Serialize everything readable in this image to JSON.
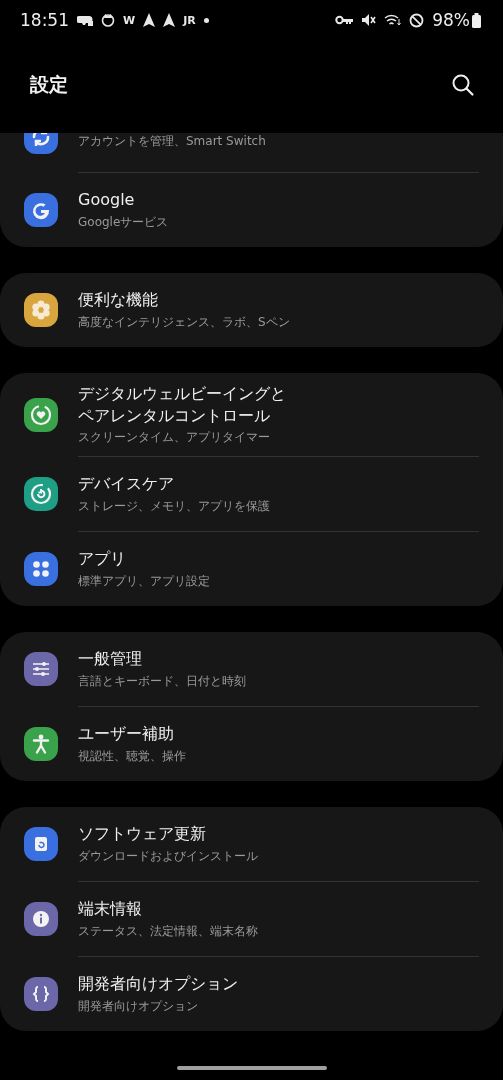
{
  "status_bar": {
    "time": "18:51",
    "notification_icons": [
      {
        "kind": "game"
      },
      {
        "kind": "cat"
      },
      {
        "kind": "text",
        "label": "W"
      },
      {
        "kind": "arrow"
      },
      {
        "kind": "arrow"
      },
      {
        "kind": "text",
        "label": "JR"
      },
      {
        "kind": "dot"
      }
    ],
    "system_icons": [
      {
        "kind": "key"
      },
      {
        "kind": "mute"
      },
      {
        "kind": "wifi"
      },
      {
        "kind": "dnd"
      }
    ],
    "battery": "98%"
  },
  "header": {
    "title": "設定"
  },
  "groups": [
    {
      "items": [
        {
          "kind": "sync",
          "color": "#3a6fe0",
          "subtitle": "アカウントを管理、Smart Switch",
          "cut": true
        },
        {
          "kind": "google",
          "color": "#3a6fe0",
          "title": "Google",
          "subtitle": "Googleサービス",
          "cut": false
        }
      ]
    },
    {
      "items": [
        {
          "kind": "flower",
          "color": "#d9a53f",
          "title": "便利な機能",
          "subtitle": "高度なインテリジェンス、ラボ、Sペン",
          "cut": false
        }
      ]
    },
    {
      "items": [
        {
          "kind": "wellbeing",
          "color": "#3aa24a",
          "title": "デジタルウェルビーイングとペアレンタルコントロール",
          "subtitle": "スクリーンタイム、アプリタイマー",
          "cut": false
        },
        {
          "kind": "devicecare",
          "color": "#1f9e86",
          "title": "デバイスケア",
          "subtitle": "ストレージ、メモリ、アプリを保護",
          "cut": false
        },
        {
          "kind": "apps",
          "color": "#3a6fe0",
          "title": "アプリ",
          "subtitle": "標準アプリ、アプリ設定",
          "cut": false
        }
      ]
    },
    {
      "items": [
        {
          "kind": "sliders",
          "color": "#6c67a8",
          "title": "一般管理",
          "subtitle": "言語とキーボード、日付と時刻",
          "cut": false
        },
        {
          "kind": "accessibility",
          "color": "#3aa24a",
          "title": "ユーザー補助",
          "subtitle": "視認性、聴覚、操作",
          "cut": false
        }
      ]
    },
    {
      "items": [
        {
          "kind": "update",
          "color": "#3a6fe0",
          "title": "ソフトウェア更新",
          "subtitle": "ダウンロードおよびインストール",
          "cut": false
        },
        {
          "kind": "info",
          "color": "#6c67a8",
          "title": "端末情報",
          "subtitle": "ステータス、法定情報、端末名称",
          "cut": false
        },
        {
          "kind": "braces",
          "color": "#6c67a8",
          "title": "開発者向けオプション",
          "subtitle": "開発者向けオプション",
          "cut": false
        }
      ]
    }
  ]
}
